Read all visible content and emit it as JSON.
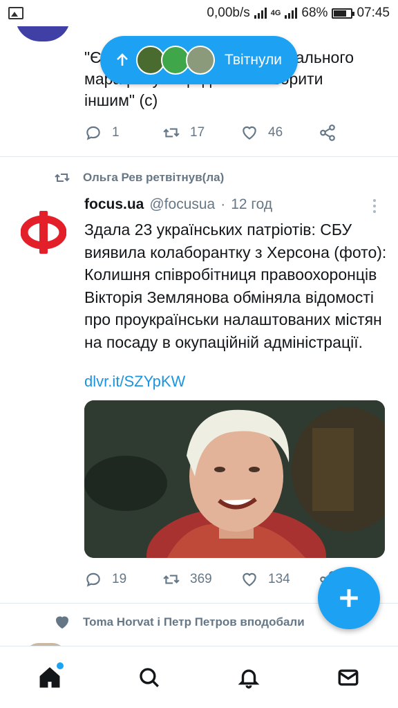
{
  "status_bar": {
    "network_speed": "0,00b/s",
    "network_type": "4G",
    "battery": "68%",
    "time": "07:45"
  },
  "previous_tweet": {
    "text_line1_start": "\"Є",
    "text_line1_end": "гального",
    "text_line2": "марафону\" - це давати говорити",
    "text_line3": "іншим\" (с)",
    "reply_count": "1",
    "retweet_count": "17",
    "like_count": "46"
  },
  "new_tweets_pill": {
    "label": "Твітнули"
  },
  "tweet": {
    "social_context": "Ольга Рев ретвітнув(ла)",
    "author_name": "focus.ua",
    "author_handle": "@focusua",
    "separator": "·",
    "time_ago": "12 год",
    "logo_letter": "Ф",
    "text": "Здала 23 українських патріотів: СБУ виявила колаборантку з Херсона (фото): Колишня співробітниця правоохоронців Вікторія Землянова обміняла відомості про проукраїнськи налаштованих містян на посаду в окупаційній адміністрації.",
    "link": "dlvr.it/SZYpKW",
    "reply_count": "19",
    "retweet_count": "369",
    "like_count": "134"
  },
  "next_tweet": {
    "social_context": "Toma Horvat і Петр Петров вподобали"
  },
  "icons": {
    "home": "home-icon",
    "search": "search-icon",
    "notifications": "bell-icon",
    "messages": "envelope-icon",
    "compose": "plus-icon"
  },
  "colors": {
    "accent": "#1da1f2",
    "link": "#1b95e0",
    "muted": "#657786",
    "logo_red": "#e3202a"
  }
}
